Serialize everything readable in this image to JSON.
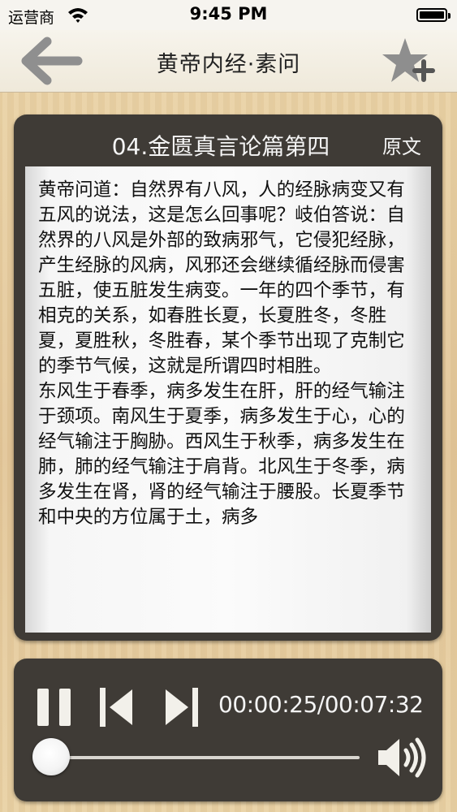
{
  "status_bar": {
    "carrier": "运营商",
    "time": "9:45 PM",
    "battery_level": 1.0
  },
  "nav": {
    "title": "黄帝内经·素问",
    "back_icon": "arrow-left-icon",
    "favorite_icon": "star-plus-icon"
  },
  "chapter": {
    "title": "04.金匮真言论篇第四",
    "original_button": "原文",
    "text": "黄帝问道：自然界有八风，人的经脉病变又有五风的说法，这是怎么回事呢？岐伯答说：自然界的八风是外部的致病邪气，它侵犯经脉，产生经脉的风病，风邪还会继续循经脉而侵害五脏，使五脏发生病变。一年的四个季节，有相克的关系，如春胜长夏，长夏胜冬，冬胜夏，夏胜秋，冬胜春，某个季节出现了克制它的季节气候，这就是所谓四时相胜。\n东风生于春季，病多发生在肝，肝的经气输注于颈项。南风生于夏季，病多发生于心，心的经气输注于胸胁。西风生于秋季，病多发生在肺，肺的经气输注于肩背。北风生于冬季，病多发生在肾，肾的经气输注于腰股。长夏季节和中央的方位属于土，病多"
  },
  "player": {
    "time_readout": "00:00:25/00:07:32",
    "progress": 0.0553,
    "pause_icon": "pause-icon",
    "prev_icon": "skip-previous-icon",
    "next_icon": "skip-next-icon",
    "volume_icon": "speaker-volume-icon"
  },
  "colors": {
    "panel": "#3f3b36",
    "background": "#e7cfa3",
    "progress_fill": "#c87a2a"
  }
}
